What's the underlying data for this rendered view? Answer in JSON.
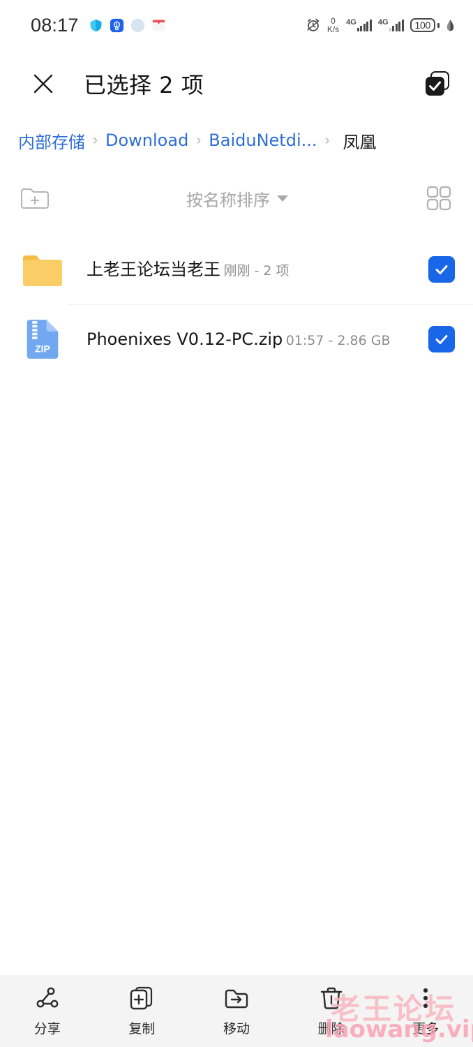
{
  "statusbar": {
    "clock": "08:17",
    "app_icons": [
      "shield-icon",
      "lightbulb-app-icon",
      "gradient-circle-icon",
      "red-app-icon"
    ],
    "alarm_icon": "alarm-icon",
    "net_speed_value": "0",
    "net_speed_unit": "K/s",
    "sim1_network": "4G",
    "sim2_network": "4G",
    "battery_level": "100",
    "battery_saver_icon": "leaf-icon"
  },
  "titlebar": {
    "close_icon": "close-icon",
    "title": "已选择 2 项",
    "select_all_icon": "select-all-icon"
  },
  "breadcrumb": {
    "separator": "›",
    "items": [
      {
        "label": "内部存储",
        "current": false
      },
      {
        "label": "Download",
        "current": false
      },
      {
        "label": "BaiduNetdi...",
        "current": false
      },
      {
        "label": "凤凰",
        "current": true
      }
    ]
  },
  "toolbar": {
    "new_folder_icon": "new-folder-icon",
    "sort_label": "按名称排序",
    "sort_caret": "caret-down-icon",
    "view_toggle_icon": "grid-view-icon"
  },
  "files": [
    {
      "icon": "folder-icon",
      "name": "上老王论坛当老王",
      "subtitle": "刚刚 - 2 项",
      "selected": true
    },
    {
      "icon": "zip-file-icon",
      "icon_label": "ZIP",
      "name": "Phoenixes V0.12-PC.zip",
      "subtitle": "01:57 - 2.86 GB",
      "selected": true
    }
  ],
  "actions": [
    {
      "icon": "share-icon",
      "label": "分享"
    },
    {
      "icon": "copy-icon",
      "label": "复制"
    },
    {
      "icon": "move-icon",
      "label": "移动"
    },
    {
      "icon": "delete-icon",
      "label": "删除"
    },
    {
      "icon": "more-icon",
      "label": "更多"
    }
  ],
  "watermark": {
    "chinese": "老王论坛",
    "english": "laowang.vip"
  },
  "colors": {
    "accent_blue": "#1a66e8",
    "link_blue": "#2e6fd4",
    "folder_yellow": "#f7c14b",
    "zip_blue": "#71a8f0",
    "bottombar_bg": "#f4f4f4",
    "watermark_pink": "#f9b6c0"
  }
}
